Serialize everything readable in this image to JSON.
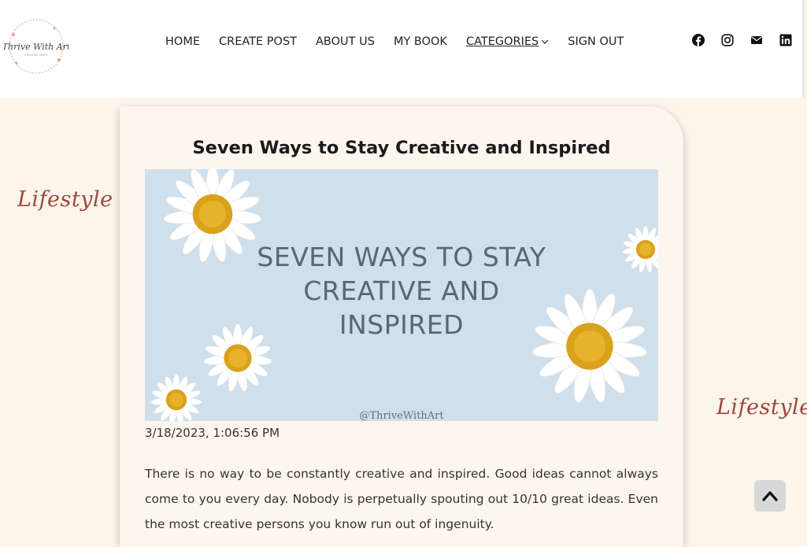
{
  "header": {
    "logo": {
      "text": "Thrive With Art",
      "subtext": "CREATIVE SPACE"
    },
    "nav": [
      {
        "label": "HOME"
      },
      {
        "label": "CREATE POST"
      },
      {
        "label": "ABOUT US"
      },
      {
        "label": "MY BOOK"
      },
      {
        "label": "CATEGORIES"
      },
      {
        "label": "SIGN OUT"
      }
    ],
    "social": [
      "facebook-icon",
      "instagram-icon",
      "mail-icon",
      "linkedin-icon"
    ]
  },
  "side_label_left": "Lifestyle",
  "side_label_right": "Lifestyle",
  "post": {
    "title": "Seven Ways to Stay Creative and Inspired",
    "hero": {
      "lines": [
        "SEVEN WAYS TO STAY",
        "CREATIVE AND",
        "INSPIRED"
      ],
      "handle": "@ThriveWithArt"
    },
    "date": "3/18/2023, 1:06:56 PM",
    "body": "There is no way to be constantly creative and inspired. Good ideas cannot always come to you every day. Nobody is perpetually spouting out 10/10 great ideas. Even the most creative persons you know run out of ingenuity."
  },
  "colors": {
    "page_bg": "#fdf4ea",
    "accent_script": "#9a4a3e",
    "hero_bg": "#cfdfec"
  }
}
